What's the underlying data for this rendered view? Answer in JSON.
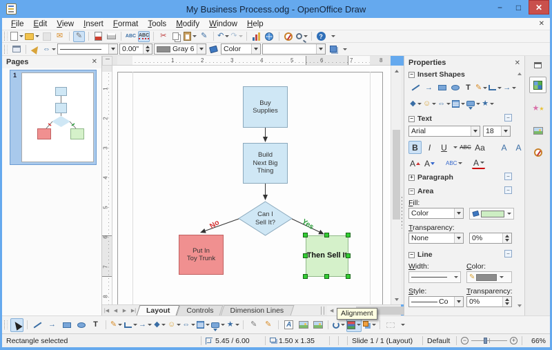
{
  "window": {
    "title": "My Business Process.odg - OpenOffice Draw"
  },
  "menu_items": [
    "File",
    "Edit",
    "View",
    "Insert",
    "Format",
    "Tools",
    "Modify",
    "Window",
    "Help"
  ],
  "toolbar_line_fill": {
    "line_width": "0.00\"",
    "line_color": "Gray 6",
    "fill_type": "Color"
  },
  "pages_panel": {
    "title": "Pages",
    "page_number": "1"
  },
  "rulers": {
    "h": [
      "1",
      "2",
      "3",
      "4",
      "5",
      "6",
      "7",
      "8"
    ],
    "v": [
      "1",
      "2",
      "3",
      "4",
      "5",
      "6",
      "7",
      "8"
    ]
  },
  "flowchart": {
    "step1": "Buy\nSupplies",
    "step2": "Build\nNext Big\nThing",
    "decision": "Can I\nSell It?",
    "no": "No",
    "yes": "Yes",
    "reject": "Put In\nToy Trunk",
    "accept": "Then Sell It"
  },
  "page_tabs": [
    "Layout",
    "Controls",
    "Dimension Lines"
  ],
  "tooltip": "Alignment",
  "sidebar": {
    "title": "Properties",
    "insert_shapes": "Insert Shapes",
    "text": "Text",
    "font_name": "Arial",
    "font_size": "18",
    "paragraph": "Paragraph",
    "area": "Area",
    "fill_label": "Fill:",
    "fill_type": "Color",
    "transparency_label": "Transparency:",
    "transparency_value": "None",
    "transparency_pct": "0%",
    "line": "Line",
    "width_label": "Width:",
    "color_label": "Color:",
    "style_label": "Style:",
    "style_value": "Co",
    "line_transparency_label": "Transparency:",
    "line_transparency_pct": "0%"
  },
  "statusbar": {
    "selection": "Rectangle selected",
    "position": "5.45 / 6.00",
    "dimensions": "1.50 x 1.35",
    "slide": "Slide 1 / 1 (Layout)",
    "template": "Default",
    "zoom_pct": "66%"
  },
  "glyphs": {
    "close": "✕",
    "minimize": "−",
    "maximize": "□",
    "scissors": "✂",
    "pencil": "✎",
    "undo": "↶",
    "redo": "↷",
    "envelope": "✉",
    "star": "★",
    "smiley": "☺",
    "diamond": "◆",
    "block_arrow": "⇔",
    "arrow_right": "→",
    "text_tool": "T",
    "abc": "ABC",
    "bold": "B",
    "italic": "I",
    "underline": "U",
    "font_a": "A",
    "aa": "Aa",
    "help_q": "?",
    "nav_first": "|◀",
    "nav_prev": "◀",
    "nav_next": "▶",
    "nav_last": "▶|",
    "scroll_left": "◀",
    "scroll_right": "▶",
    "scroll_up": "▲",
    "scroll_down": "▼",
    "expand_plus": "+",
    "collapse_minus": "−",
    "zoom_minus": "−",
    "zoom_plus": "+"
  },
  "colors": {
    "titlebar": "#65a9ee",
    "close_button": "#c9504c",
    "active_tool_bg": "#cde2f6",
    "process_fill": "#cfe7f5",
    "process_border": "#8aa8bc",
    "reject_fill": "#f09090",
    "reject_border": "#c06060",
    "accept_fill": "#d5f1ca",
    "accept_border": "#90b889",
    "selection_handle": "#33cc33",
    "no_label": "#d33333",
    "yes_label": "#2d9e3c",
    "line_color_swatch": "#8c8c8c",
    "fill_color_swatch": "#cdeec3"
  }
}
